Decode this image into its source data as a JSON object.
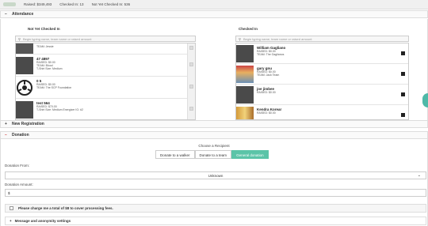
{
  "topbar": {
    "raised": "Raised: $349,493",
    "checked_in": "Checked In: 13",
    "not_yet": "Not Yet Checked In: 536"
  },
  "attendance": {
    "title": "Attendance",
    "toggle": "−",
    "left": {
      "title": "Not Yet Checked In",
      "placeholder": "Begin typing name, team name or raised amount",
      "rows": [
        {
          "name": "",
          "lines": [
            "TEAM: Jessie"
          ]
        },
        {
          "name": "47 4897",
          "lines": [
            "RAISED: $0.00",
            "TEAM: Blood",
            "T-Shirt Size: Medium"
          ]
        },
        {
          "name": "0 5",
          "lines": [
            "RAISED: $0.00",
            "TEAM: The SCP Foundation"
          ]
        },
        {
          "name": "test 564",
          "lines": [
            "RAISED: $70.00",
            "T-Shirt Size: Medium Energizer IG: #2"
          ]
        }
      ]
    },
    "right": {
      "title": "Checked In",
      "placeholder": "Begin typing name, team name or raised amount",
      "rows": [
        {
          "name": "William Gagliano",
          "lines": [
            "RAISED: $0.00",
            "TEAM: The Gaglianos"
          ]
        },
        {
          "name": "gary gnu",
          "lines": [
            "RAISED: $0.00",
            "TEAM: Jack Team"
          ]
        },
        {
          "name": "joe jimbee",
          "lines": [
            "RAISED: $0.00"
          ]
        },
        {
          "name": "Kendra Korear",
          "lines": [
            "RAISED: $0.00"
          ]
        }
      ]
    }
  },
  "new_registration": {
    "title": "New Registration",
    "toggle": "+"
  },
  "donation": {
    "title": "Donation",
    "toggle": "−",
    "recipient_label": "Choose a Recipient",
    "buttons": [
      "Donate to a walker",
      "Donate to a team",
      "General donation"
    ],
    "from_label": "Donation From:",
    "from_value": "Unknown",
    "amount_label": "Donation Amount:",
    "amount_value": "$",
    "fee_text": "Please charge me a total of $8 to cover processing fees.",
    "message_label": "Message and anonymity settings",
    "message_toggle": "+"
  },
  "colors": {
    "accent": "#5cc4a8",
    "fab": "#4fb9a8"
  }
}
